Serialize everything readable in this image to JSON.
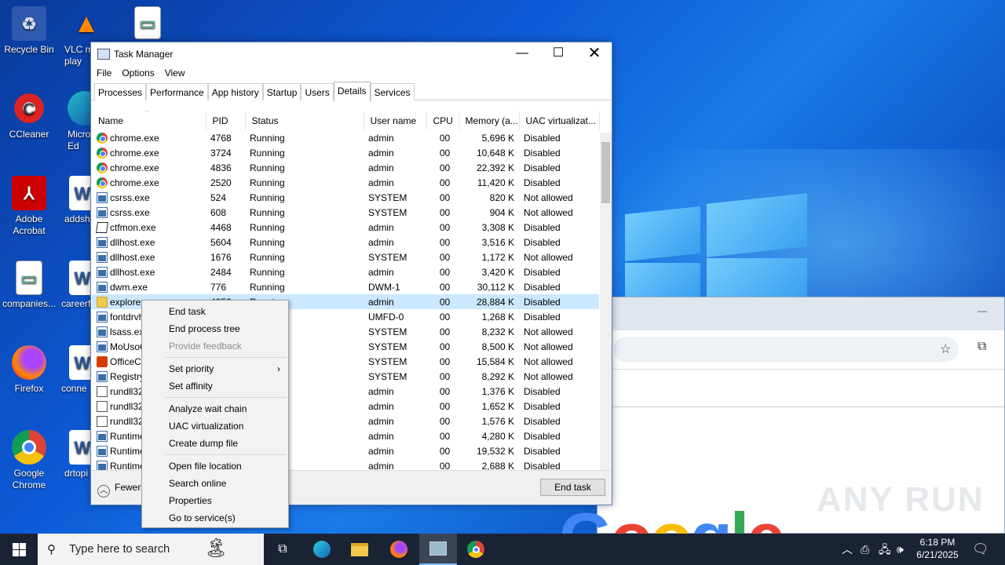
{
  "desktop": {
    "icons": [
      {
        "label": "Recycle Bin",
        "icon": "recycle-bin-icon"
      },
      {
        "label": "VLC m\nplay",
        "icon": "vlc-icon"
      },
      {
        "label": "",
        "icon": "image-file-icon"
      },
      {
        "label": "CCleaner",
        "icon": "ccleaner-icon"
      },
      {
        "label": "Micro\nEd",
        "icon": "edge-icon"
      },
      {
        "label": "Adobe\nAcrobat",
        "icon": "acrobat-icon"
      },
      {
        "label": "addsh",
        "icon": "word-doc-icon"
      },
      {
        "label": "companies...",
        "icon": "image-file-icon"
      },
      {
        "label": "careerf",
        "icon": "word-doc-icon"
      },
      {
        "label": "Firefox",
        "icon": "firefox-icon"
      },
      {
        "label": "conne",
        "icon": "word-doc-icon"
      },
      {
        "label": "Google\nChrome",
        "icon": "chrome-icon"
      },
      {
        "label": "drtopi",
        "icon": "word-doc-icon"
      }
    ],
    "watermark": "ANY RUN",
    "google_logo": "Google"
  },
  "taskmanager": {
    "title": "Task Manager",
    "menu": [
      "File",
      "Options",
      "View"
    ],
    "tabs": [
      "Processes",
      "Performance",
      "App history",
      "Startup",
      "Users",
      "Details",
      "Services"
    ],
    "active_tab": "Details",
    "columns": [
      "Name",
      "PID",
      "Status",
      "User name",
      "CPU",
      "Memory (a...",
      "UAC virtualizat..."
    ],
    "rows": [
      {
        "icon": "chrome",
        "name": "chrome.exe",
        "pid": "4768",
        "status": "Running",
        "user": "admin",
        "cpu": "00",
        "mem": "5,696 K",
        "uac": "Disabled"
      },
      {
        "icon": "chrome",
        "name": "chrome.exe",
        "pid": "3724",
        "status": "Running",
        "user": "admin",
        "cpu": "00",
        "mem": "10,648 K",
        "uac": "Disabled"
      },
      {
        "icon": "chrome",
        "name": "chrome.exe",
        "pid": "4836",
        "status": "Running",
        "user": "admin",
        "cpu": "00",
        "mem": "22,392 K",
        "uac": "Disabled"
      },
      {
        "icon": "chrome",
        "name": "chrome.exe",
        "pid": "2520",
        "status": "Running",
        "user": "admin",
        "cpu": "00",
        "mem": "11,420 K",
        "uac": "Disabled"
      },
      {
        "icon": "win",
        "name": "csrss.exe",
        "pid": "524",
        "status": "Running",
        "user": "SYSTEM",
        "cpu": "00",
        "mem": "820 K",
        "uac": "Not allowed"
      },
      {
        "icon": "win",
        "name": "csrss.exe",
        "pid": "608",
        "status": "Running",
        "user": "SYSTEM",
        "cpu": "00",
        "mem": "904 K",
        "uac": "Not allowed"
      },
      {
        "icon": "edit",
        "name": "ctfmon.exe",
        "pid": "4468",
        "status": "Running",
        "user": "admin",
        "cpu": "00",
        "mem": "3,308 K",
        "uac": "Disabled"
      },
      {
        "icon": "win",
        "name": "dllhost.exe",
        "pid": "5604",
        "status": "Running",
        "user": "admin",
        "cpu": "00",
        "mem": "3,516 K",
        "uac": "Disabled"
      },
      {
        "icon": "win",
        "name": "dllhost.exe",
        "pid": "1676",
        "status": "Running",
        "user": "SYSTEM",
        "cpu": "00",
        "mem": "1,172 K",
        "uac": "Not allowed"
      },
      {
        "icon": "win",
        "name": "dllhost.exe",
        "pid": "2484",
        "status": "Running",
        "user": "admin",
        "cpu": "00",
        "mem": "3,420 K",
        "uac": "Disabled"
      },
      {
        "icon": "win",
        "name": "dwm.exe",
        "pid": "776",
        "status": "Running",
        "user": "DWM-1",
        "cpu": "00",
        "mem": "30,112 K",
        "uac": "Disabled"
      },
      {
        "icon": "folder",
        "name": "explorer",
        "pid": "4952",
        "status": "Running",
        "user": "admin",
        "cpu": "00",
        "mem": "28,884 K",
        "uac": "Disabled",
        "selected": true
      },
      {
        "icon": "win",
        "name": "fontdrvh",
        "pid": "",
        "status": "",
        "user": "UMFD-0",
        "cpu": "00",
        "mem": "1,268 K",
        "uac": "Disabled"
      },
      {
        "icon": "win",
        "name": "lsass.exe",
        "pid": "",
        "status": "",
        "user": "SYSTEM",
        "cpu": "00",
        "mem": "8,232 K",
        "uac": "Not allowed"
      },
      {
        "icon": "win",
        "name": "MoUsoC",
        "pid": "",
        "status": "",
        "user": "SYSTEM",
        "cpu": "00",
        "mem": "8,500 K",
        "uac": "Not allowed"
      },
      {
        "icon": "office",
        "name": "OfficeCl",
        "pid": "",
        "status": "",
        "user": "SYSTEM",
        "cpu": "00",
        "mem": "15,584 K",
        "uac": "Not allowed"
      },
      {
        "icon": "win",
        "name": "Registry",
        "pid": "",
        "status": "",
        "user": "SYSTEM",
        "cpu": "00",
        "mem": "8,292 K",
        "uac": "Not allowed"
      },
      {
        "icon": "doc",
        "name": "rundll32",
        "pid": "",
        "status": "",
        "user": "admin",
        "cpu": "00",
        "mem": "1,376 K",
        "uac": "Disabled"
      },
      {
        "icon": "doc",
        "name": "rundll32",
        "pid": "",
        "status": "",
        "user": "admin",
        "cpu": "00",
        "mem": "1,652 K",
        "uac": "Disabled"
      },
      {
        "icon": "doc",
        "name": "rundll32",
        "pid": "",
        "status": "",
        "user": "admin",
        "cpu": "00",
        "mem": "1,576 K",
        "uac": "Disabled"
      },
      {
        "icon": "win",
        "name": "Runtime",
        "pid": "",
        "status": "",
        "user": "admin",
        "cpu": "00",
        "mem": "4,280 K",
        "uac": "Disabled"
      },
      {
        "icon": "win",
        "name": "Runtime",
        "pid": "",
        "status": "",
        "user": "admin",
        "cpu": "00",
        "mem": "19,532 K",
        "uac": "Disabled"
      },
      {
        "icon": "win",
        "name": "Runtime",
        "pid": "",
        "status": "",
        "user": "admin",
        "cpu": "00",
        "mem": "2,688 K",
        "uac": "Disabled"
      }
    ],
    "fewer_details": "Fewer details",
    "end_task": "End task"
  },
  "context_menu": {
    "groups": [
      [
        {
          "label": "End task"
        },
        {
          "label": "End process tree"
        },
        {
          "label": "Provide feedback",
          "disabled": true
        }
      ],
      [
        {
          "label": "Set priority",
          "submenu": true
        },
        {
          "label": "Set affinity"
        }
      ],
      [
        {
          "label": "Analyze wait chain"
        },
        {
          "label": "UAC virtualization"
        },
        {
          "label": "Create dump file"
        }
      ],
      [
        {
          "label": "Open file location"
        },
        {
          "label": "Search online"
        },
        {
          "label": "Properties"
        },
        {
          "label": "Go to service(s)"
        }
      ]
    ]
  },
  "taskbar": {
    "search_placeholder": "Type here to search",
    "time": "6:18 PM",
    "date": "6/21/2025"
  }
}
